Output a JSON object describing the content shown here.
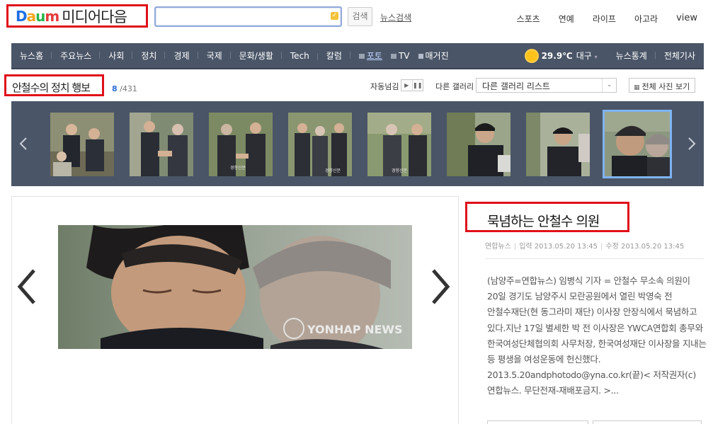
{
  "header": {
    "logo_brand": "Daum",
    "logo_text": "미디어다음",
    "search": {
      "value": "",
      "placeholder": ""
    },
    "search_button": "검색",
    "news_search_link": "뉴스검색",
    "top_nav": [
      "스포츠",
      "연예",
      "라이프",
      "아고라",
      "view"
    ]
  },
  "navbar": {
    "items": [
      "뉴스홈",
      "주요뉴스",
      "사회",
      "정치",
      "경제",
      "국제",
      "문화/생활",
      "Tech",
      "칼럼"
    ],
    "media_links": [
      "포토",
      "TV",
      "매거진"
    ],
    "weather": {
      "temperature": "29.9℃",
      "city": "대구"
    },
    "right_links": [
      "뉴스통계",
      "전체기사"
    ]
  },
  "gallery": {
    "title": "안철수의 정치 행보",
    "current": "8",
    "total": "/431",
    "autoplay_label": "자동넘김",
    "other_gallery_label": "다른 갤러리",
    "select_value": "다른 갤러리 리스트",
    "all_photos_button": "전체 사진 보기",
    "thumbnail_count": 8,
    "active_index": 7
  },
  "photo": {
    "watermark": "YONHAP NEWS"
  },
  "article": {
    "title": "묵념하는 안철수 의원",
    "source": "연합뉴스",
    "posted": "입력 2013.05.20 13:45",
    "modified": "수정 2013.05.20 13:45",
    "body": "(남양주=연합뉴스) 임병식 기자 = 안철수 무소속 의원이 20일 경기도 남양주시 모란공원에서 열린 박영숙 전 안철수재단(현 동그라미 재단) 이사장 안장식에서 묵념하고 있다.지난 17일 별세한 박 전 이사장은 YWCA연합회 총무와 한국여성단체협의회 사무처장, 한국여성재단 이사장을 지내는 등 평생을 여성운동에 헌신했다. 2013.5.20andphotodo@yna.co.kr(끝)< 저작권자(c)연합뉴스. 무단전재-재배포금지. >..."
  },
  "colors": {
    "highlight_border": "#e0101a",
    "navbar_bg": "#4a5567",
    "active_thumb_border": "#7fb3f5",
    "counter_accent": "#2d6fd6"
  }
}
